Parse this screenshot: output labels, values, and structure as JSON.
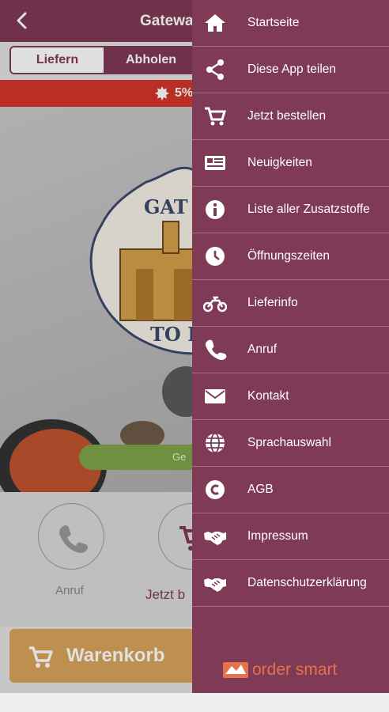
{
  "app": {
    "title": "Gateway",
    "tabs": {
      "liefern": "Liefern",
      "abholen": "Abholen"
    },
    "promo_text": "5%",
    "order_button": "Ge",
    "logo_text_top": "GAT",
    "logo_text_bottom": "TO I",
    "actions": {
      "call_label": "Anruf",
      "order_label": "Jetzt b"
    },
    "cart_label": "Warenkorb"
  },
  "drawer": {
    "items": [
      {
        "label": "Startseite",
        "icon": "home-icon"
      },
      {
        "label": "Diese App teilen",
        "icon": "share-icon"
      },
      {
        "label": "Jetzt bestellen",
        "icon": "cart-icon"
      },
      {
        "label": "Neuigkeiten",
        "icon": "news-icon"
      },
      {
        "label": "Liste aller Zusatzstoffe",
        "icon": "info-icon"
      },
      {
        "label": "Öffnungszeiten",
        "icon": "clock-icon"
      },
      {
        "label": "Lieferinfo",
        "icon": "motorbike-icon"
      },
      {
        "label": "Anruf",
        "icon": "phone-icon"
      },
      {
        "label": "Kontakt",
        "icon": "envelope-icon"
      },
      {
        "label": "Sprachauswahl",
        "icon": "globe-icon"
      },
      {
        "label": "AGB",
        "icon": "copyright-icon"
      },
      {
        "label": "Impressum",
        "icon": "handshake-icon"
      },
      {
        "label": "Datenschutzerklärung",
        "icon": "handshake-icon"
      }
    ],
    "brand": "order smart"
  },
  "colors": {
    "primary": "#7f3a55",
    "promo": "#d4362b",
    "accent": "#d8a45c",
    "green": "#7fa34a",
    "brand": "#e3734a"
  }
}
